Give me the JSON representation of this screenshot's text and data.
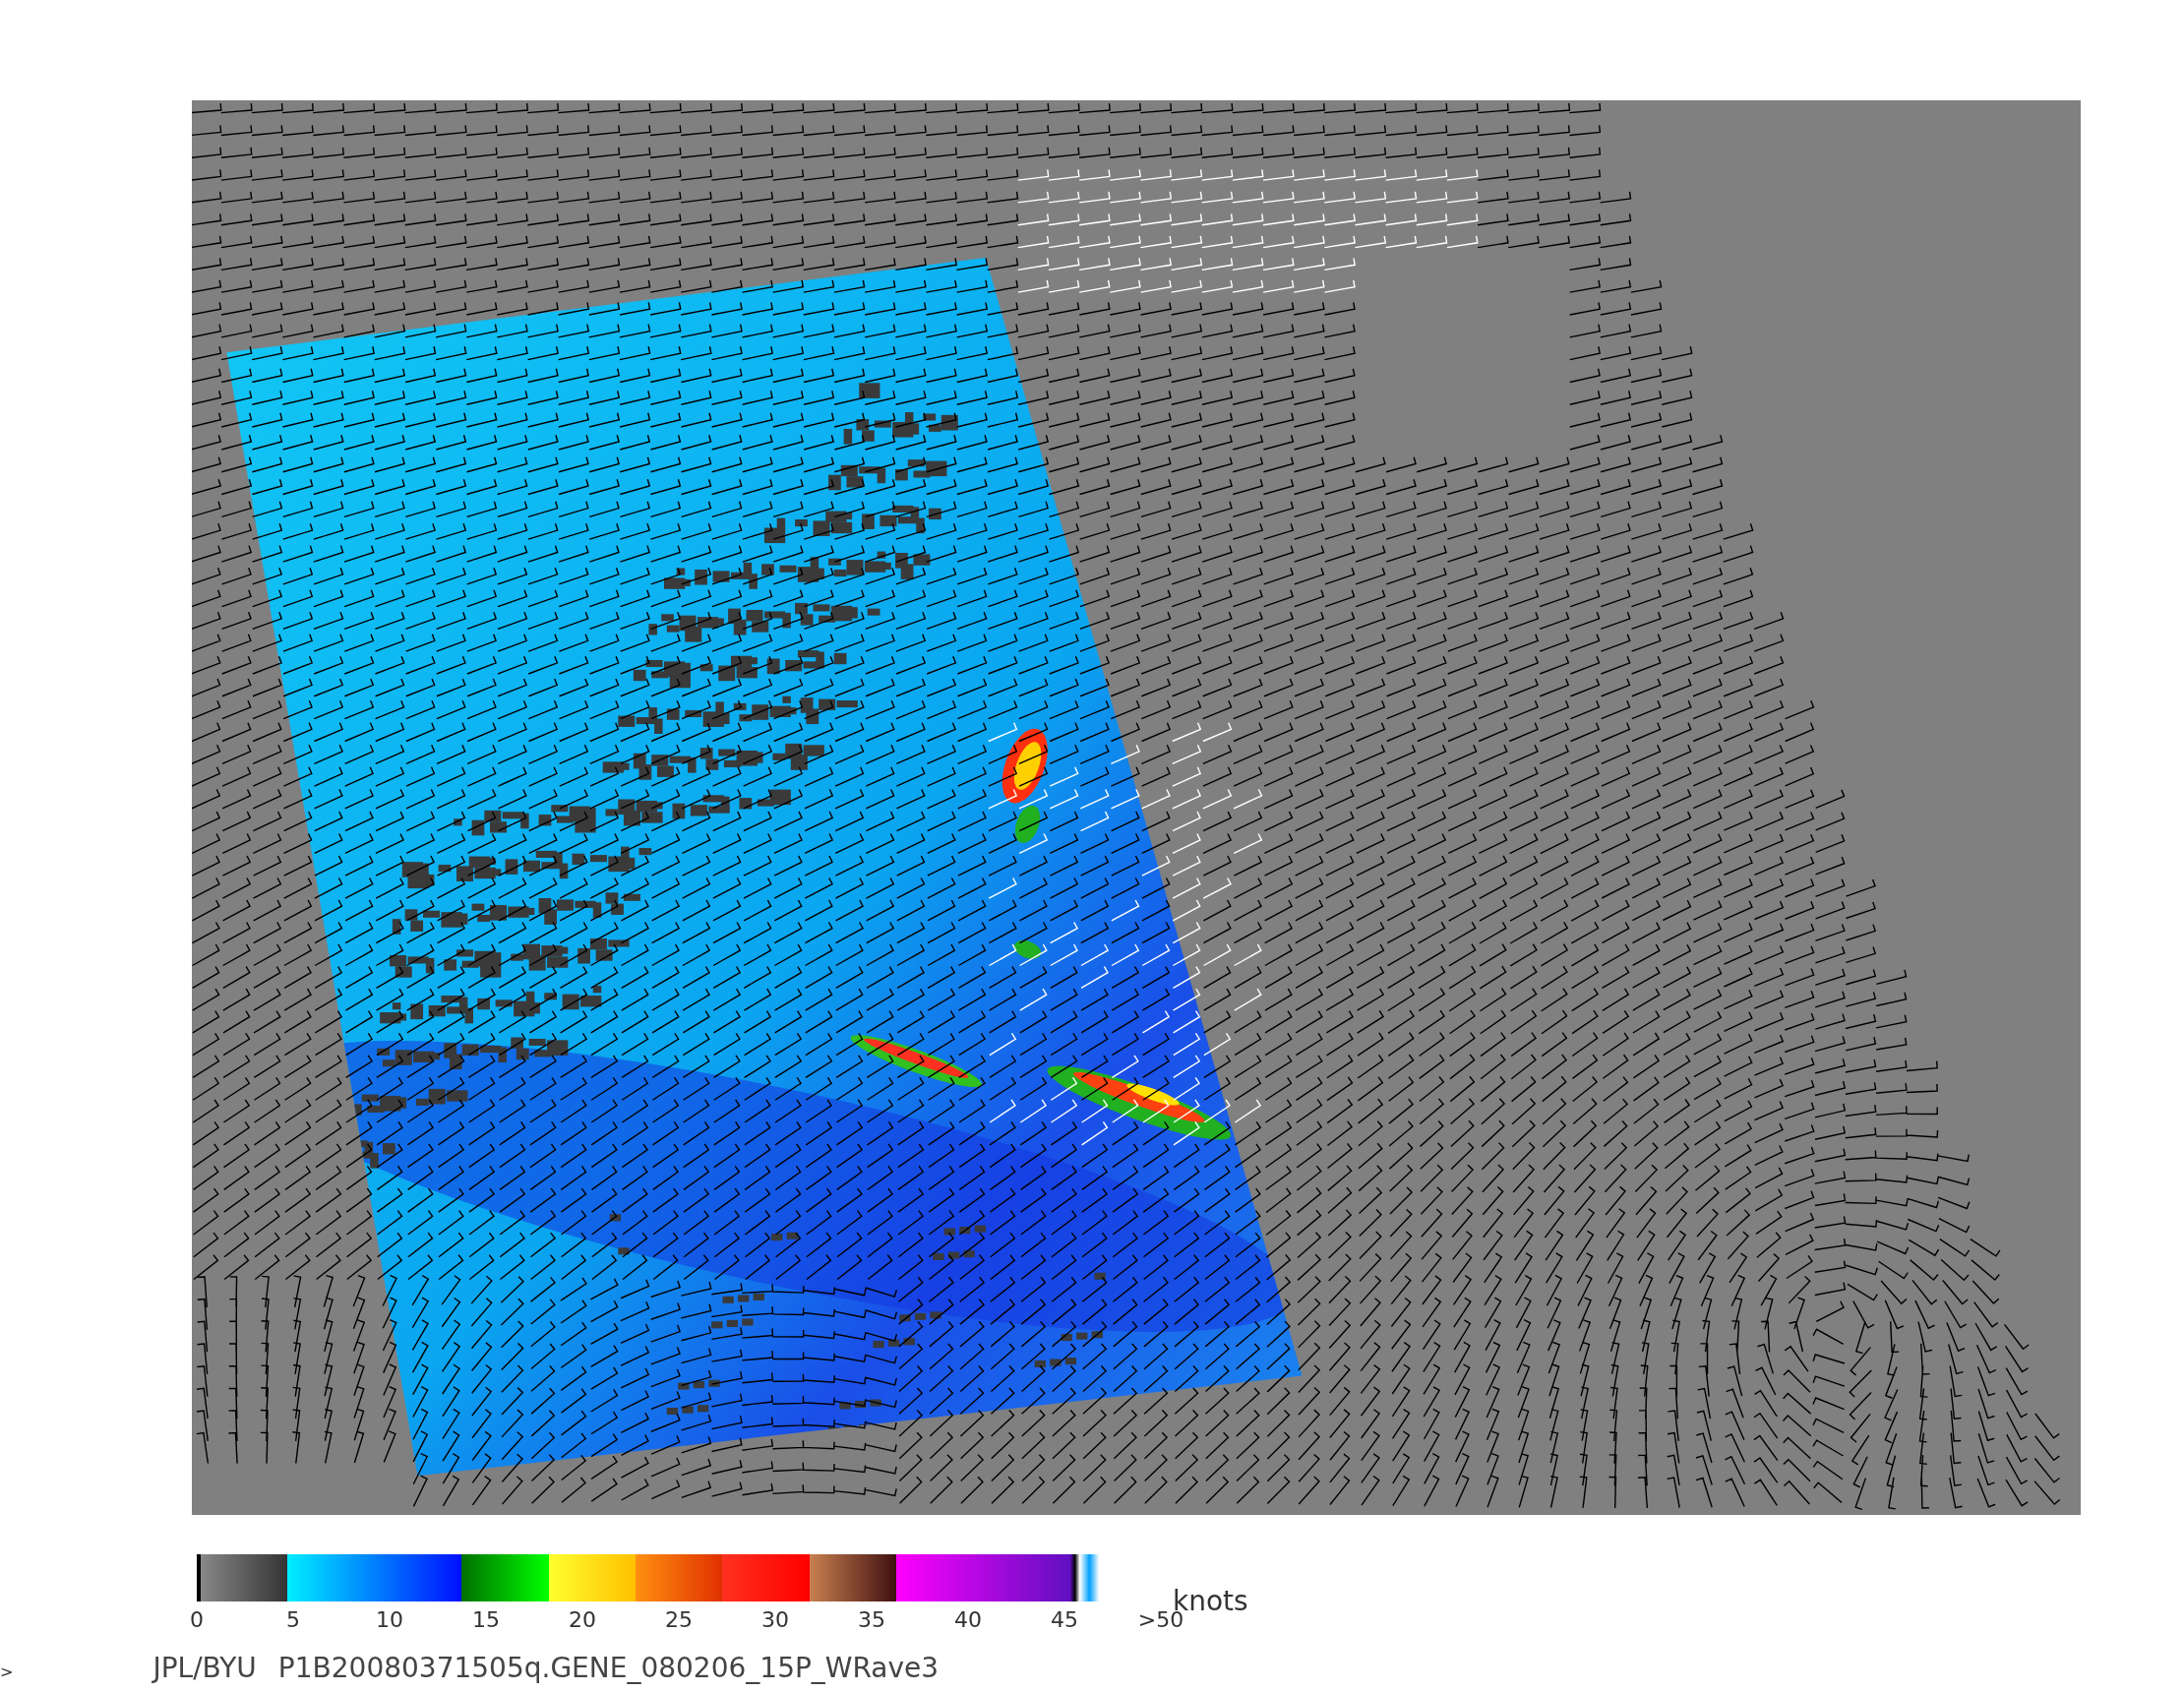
{
  "colorbar": {
    "unit": "knots",
    "ticks": [
      "0",
      "5",
      "10",
      "15",
      "20",
      "25",
      "30",
      "35",
      "40",
      "45",
      ">50"
    ]
  },
  "footer": {
    "source": "JPL/BYU",
    "product": "P1B20080371505q.GENE_080206_15P_WRave3"
  },
  "edge_mark": ">"
}
